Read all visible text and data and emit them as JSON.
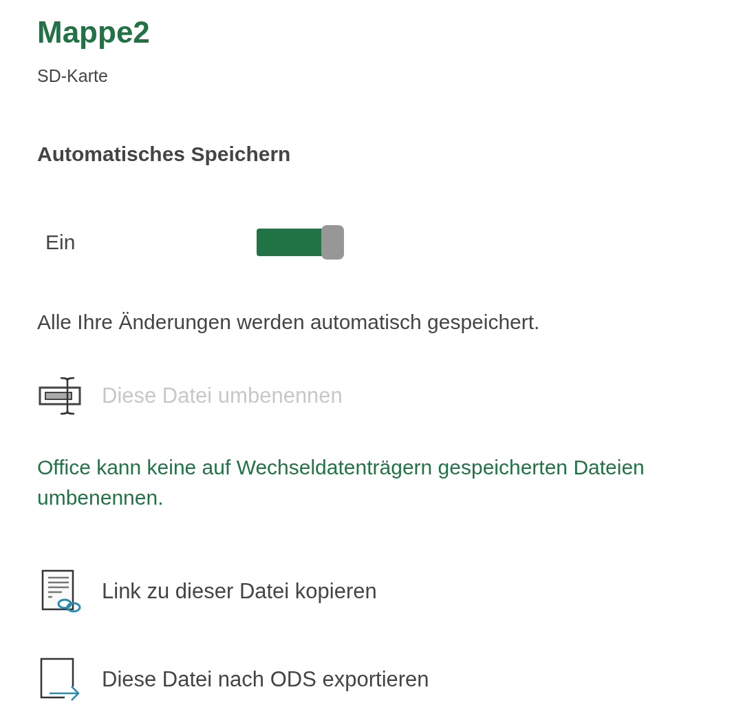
{
  "title": "Mappe2",
  "location": "SD-Karte",
  "autosave": {
    "heading": "Automatisches Speichern",
    "label": "Ein",
    "on": true,
    "description": "Alle Ihre Änderungen werden automatisch gespeichert."
  },
  "actions": [
    {
      "kind": "rename",
      "label": "Diese Datei umbenennen",
      "disabled": true,
      "note": "Office kann keine auf Wechseldatenträgern gespeicherten Dateien umbenennen."
    },
    {
      "kind": "link",
      "label": "Link zu dieser Datei kopieren",
      "disabled": false
    },
    {
      "kind": "export",
      "label": "Diese Datei nach ODS exportieren",
      "disabled": false
    }
  ]
}
